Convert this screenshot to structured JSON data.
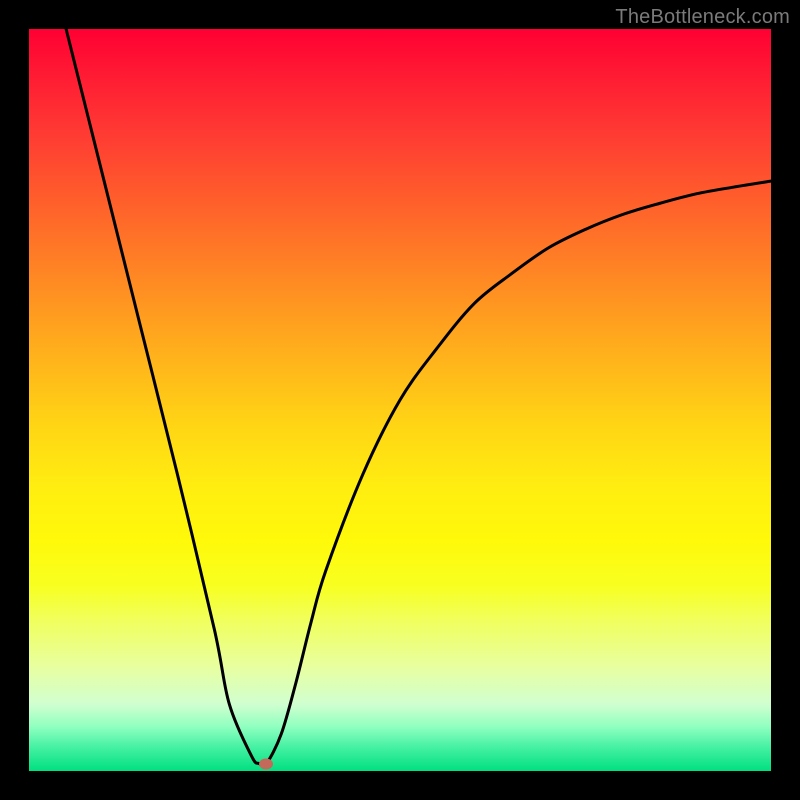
{
  "watermark": "TheBottleneck.com",
  "chart_data": {
    "type": "line",
    "title": "",
    "xlabel": "",
    "ylabel": "",
    "xlim": [
      0,
      100
    ],
    "ylim": [
      0,
      100
    ],
    "series": [
      {
        "name": "curve",
        "x": [
          5,
          10,
          15,
          20,
          25,
          27,
          30,
          31,
          32,
          34,
          36,
          38,
          40,
          45,
          50,
          55,
          60,
          65,
          70,
          75,
          80,
          85,
          90,
          95,
          100
        ],
        "values": [
          100,
          80,
          60,
          40,
          19,
          9,
          2,
          1,
          1,
          5,
          12,
          20,
          27,
          40,
          50,
          57,
          63,
          67,
          70.5,
          73,
          75,
          76.5,
          77.8,
          78.7,
          79.5
        ]
      }
    ],
    "marker": {
      "x": 32,
      "y": 1
    },
    "background_gradient": {
      "top": "#ff0033",
      "middle": "#ffee10",
      "bottom": "#00e080"
    },
    "colors": {
      "curve": "#000000",
      "marker": "#c46a5a",
      "frame": "#000000"
    }
  }
}
